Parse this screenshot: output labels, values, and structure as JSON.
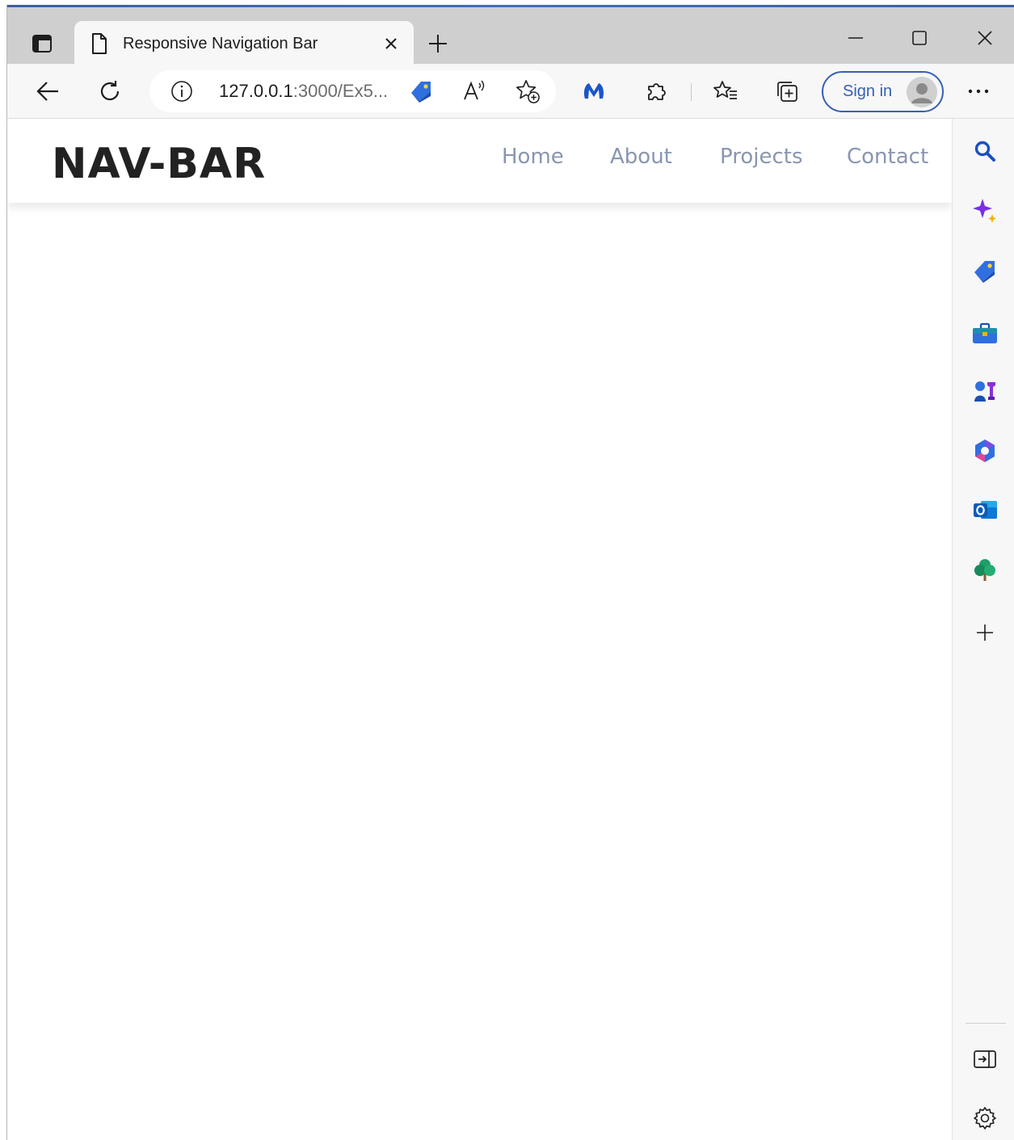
{
  "browser": {
    "tab": {
      "title": "Responsive Navigation Bar",
      "icon": "page-icon"
    },
    "address_bar": {
      "url_host": "127.0.0.1",
      "url_path": ":3000/Ex5..."
    },
    "sign_in_label": "Sign in",
    "icons": {
      "tab_actions": "tab-actions-icon",
      "new_tab": "plus-icon",
      "minimize": "minimize-icon",
      "maximize": "maximize-icon",
      "close": "close-icon",
      "back": "back-arrow-icon",
      "refresh": "refresh-icon",
      "info": "info-icon",
      "coupon": "tag-icon",
      "read_aloud": "read-aloud-icon",
      "add_favorite": "star-plus-icon",
      "malwarebytes": "malwarebytes-icon",
      "extensions": "puzzle-icon",
      "favorites": "favorites-icon",
      "collections": "collections-icon",
      "more": "more-icon"
    }
  },
  "page": {
    "logo": "NAV-BAR",
    "nav_links": [
      {
        "label": "Home"
      },
      {
        "label": "About"
      },
      {
        "label": "Projects"
      },
      {
        "label": "Contact"
      }
    ],
    "nav_link_color": "#8896b0"
  },
  "sidebar": {
    "icons": [
      "search-icon",
      "copilot-sparkle-icon",
      "shopping-tag-icon",
      "tools-icon",
      "games-icon",
      "microsoft-365-icon",
      "outlook-icon",
      "drop-tree-icon",
      "add-icon",
      "hide-sidebar-icon",
      "settings-icon"
    ]
  },
  "colors": {
    "accent": "#3560b8",
    "toolbar_bg": "#f7f7f7",
    "tabstrip_bg": "#cfcfcf"
  }
}
